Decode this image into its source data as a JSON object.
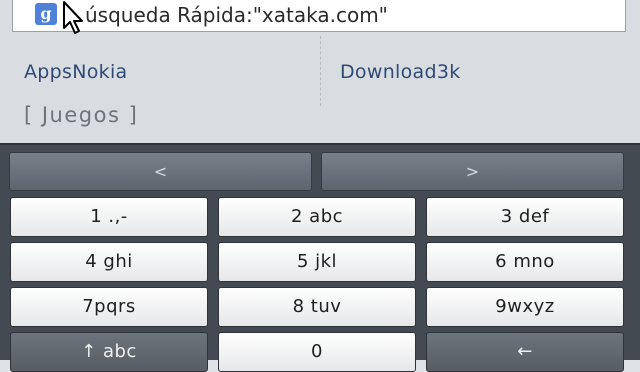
{
  "search": {
    "icon": "google-g-icon",
    "icon_glyph": "g",
    "text": "úsqueda Rápida:\"xataka.com\""
  },
  "links": {
    "left": "AppsNokia",
    "right": "Download3k",
    "category": "[ Juegos ]"
  },
  "keyboard": {
    "prev_label": "<",
    "next_label": ">",
    "keys": [
      [
        "1 .,-",
        "2 abc",
        "3 def"
      ],
      [
        "4 ghi",
        "5 jkl",
        "6 mno"
      ],
      [
        "7pqrs",
        "8 tuv",
        "9wxyz"
      ],
      [
        "↑ abc",
        "0",
        "←"
      ]
    ]
  },
  "colors": {
    "keyboard_bg": "#444a52",
    "key_face": "#ffffff",
    "link": "#2e4a76",
    "google_blue": "#4f82d6"
  }
}
